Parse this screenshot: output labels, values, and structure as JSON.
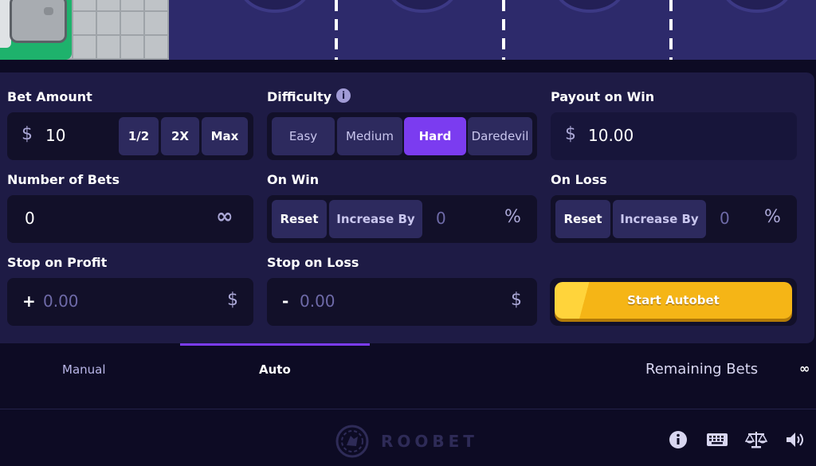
{
  "bet_amount": {
    "label": "Bet Amount",
    "currency": "$",
    "value": "10",
    "buttons": [
      "1/2",
      "2X",
      "Max"
    ]
  },
  "difficulty": {
    "label": "Difficulty",
    "info": "i",
    "options": [
      "Easy",
      "Medium",
      "Hard",
      "Daredevil"
    ],
    "selected": "Hard"
  },
  "payout": {
    "label": "Payout on Win",
    "currency": "$",
    "value": "10.00"
  },
  "number_of_bets": {
    "label": "Number of Bets",
    "value": "0",
    "infinity_symbol": "∞"
  },
  "on_win": {
    "label": "On Win",
    "reset": "Reset",
    "increase": "Increase By",
    "value": "0",
    "unit": "%"
  },
  "on_loss": {
    "label": "On Loss",
    "reset": "Reset",
    "increase": "Increase By",
    "value": "0",
    "unit": "%"
  },
  "stop_profit": {
    "label": "Stop on Profit",
    "sign": "+",
    "placeholder": "0.00",
    "currency": "$"
  },
  "stop_loss": {
    "label": "Stop on Loss",
    "sign": "-",
    "placeholder": "0.00",
    "currency": "$"
  },
  "start_autobet": "Start Autobet",
  "tabs": {
    "manual": "Manual",
    "auto": "Auto",
    "active": "Auto"
  },
  "remaining_bets": {
    "label": "Remaining Bets",
    "value": "∞"
  },
  "brand": "ROOBET",
  "footer_icons": [
    "info-icon",
    "keyboard-icon",
    "scales-icon",
    "speaker-icon"
  ],
  "colors": {
    "accent": "#7b3cf0",
    "panel": "#1e1b45",
    "field": "#121029",
    "button_yellow": "#f5b516"
  }
}
